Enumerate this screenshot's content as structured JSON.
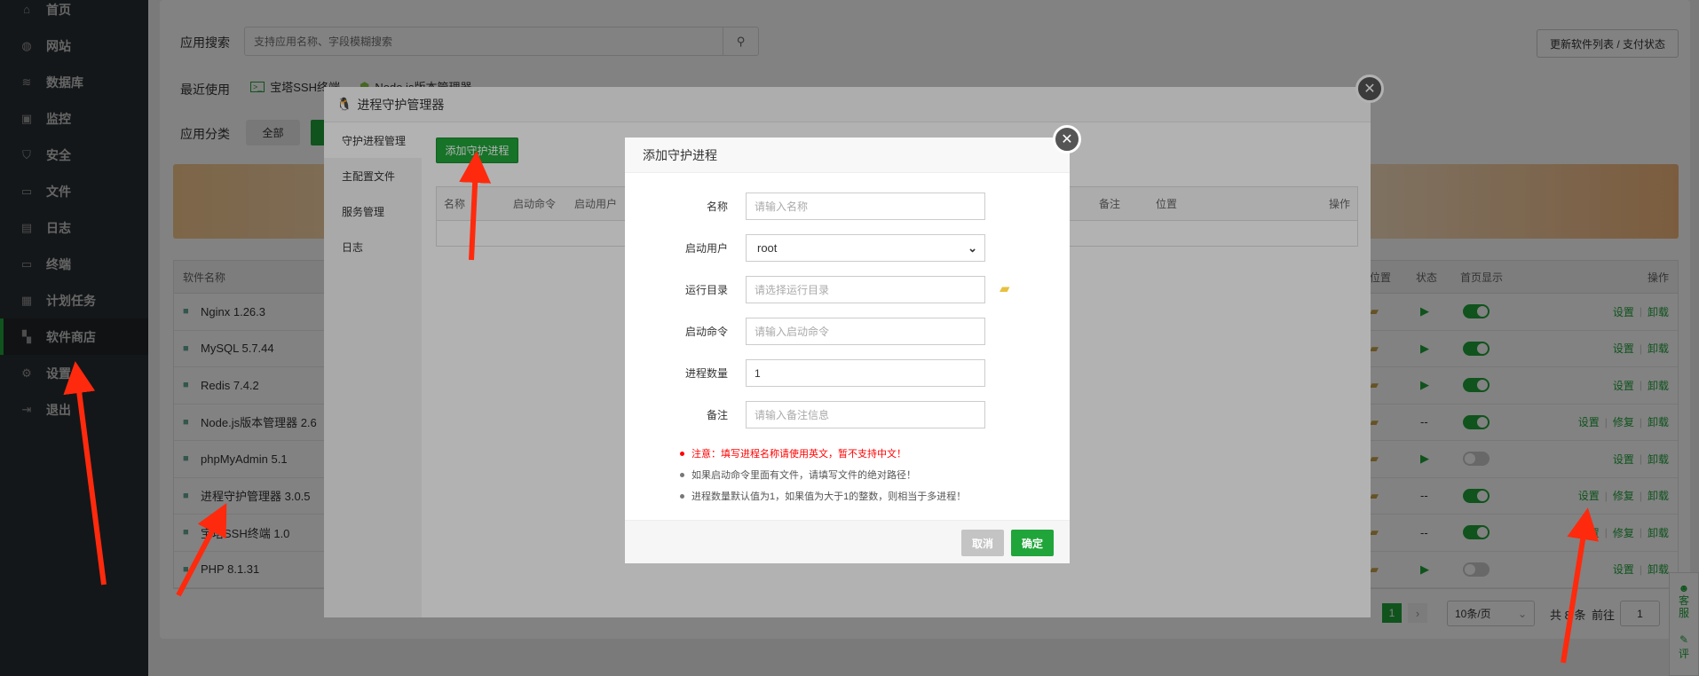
{
  "sidebar": {
    "items": [
      {
        "label": "首页",
        "icon": "home-icon",
        "glyph": "⌂"
      },
      {
        "label": "网站",
        "icon": "globe-icon",
        "glyph": "◍"
      },
      {
        "label": "数据库",
        "icon": "database-icon",
        "glyph": "≋"
      },
      {
        "label": "监控",
        "icon": "monitor-icon",
        "glyph": "▣"
      },
      {
        "label": "安全",
        "icon": "shield-icon",
        "glyph": "⛉"
      },
      {
        "label": "文件",
        "icon": "folder-icon",
        "glyph": "▭"
      },
      {
        "label": "日志",
        "icon": "log-icon",
        "glyph": "▤"
      },
      {
        "label": "终端",
        "icon": "terminal-icon",
        "glyph": "▭"
      },
      {
        "label": "计划任务",
        "icon": "calendar-icon",
        "glyph": "▦"
      },
      {
        "label": "软件商店",
        "icon": "apps-icon",
        "glyph": "▚"
      },
      {
        "label": "设置",
        "icon": "gear-icon",
        "glyph": "⚙"
      },
      {
        "label": "退出",
        "icon": "logout-icon",
        "glyph": "⇥"
      }
    ],
    "active": 9
  },
  "header": {
    "search_label": "应用搜索",
    "search_placeholder": "支持应用名称、字段模糊搜索",
    "update_button": "更新软件列表 / 支付状态",
    "recent_label": "最近使用",
    "recent": [
      "宝塔SSH终端",
      "Node.js版本管理器"
    ],
    "category_label": "应用分类",
    "category_all": "全部"
  },
  "table": {
    "headers": {
      "name": "软件名称",
      "location": "位置",
      "status": "状态",
      "home": "首页显示",
      "ops": "操作"
    },
    "rows": [
      {
        "name": "Nginx 1.26.3",
        "running": true,
        "home": true,
        "ops": [
          "设置",
          "卸载"
        ]
      },
      {
        "name": "MySQL 5.7.44",
        "running": true,
        "home": true,
        "ops": [
          "设置",
          "卸载"
        ]
      },
      {
        "name": "Redis 7.4.2",
        "running": true,
        "home": true,
        "ops": [
          "设置",
          "卸载"
        ]
      },
      {
        "name": "Node.js版本管理器 2.6",
        "running": null,
        "home": true,
        "ops": [
          "设置",
          "修复",
          "卸载"
        ]
      },
      {
        "name": "phpMyAdmin 5.1",
        "running": true,
        "home": false,
        "ops": [
          "设置",
          "卸载"
        ]
      },
      {
        "name": "进程守护管理器 3.0.5",
        "running": null,
        "home": true,
        "ops": [
          "设置",
          "修复",
          "卸载"
        ]
      },
      {
        "name": "宝塔SSH终端 1.0",
        "running": null,
        "home": true,
        "ops": [
          "设置",
          "修复",
          "卸载"
        ]
      },
      {
        "name": "PHP 8.1.31",
        "running": true,
        "home": false,
        "ops": [
          "设置",
          "卸载"
        ]
      }
    ],
    "status_none": "--"
  },
  "pagination": {
    "current": "1",
    "page_size": "10条/页",
    "total": "共 8 条",
    "goto_label": "前往",
    "goto_value": "1"
  },
  "float_tabs": [
    "客服",
    "评"
  ],
  "process_manager": {
    "title": "进程守护管理器",
    "nav": [
      "守护进程管理",
      "主配置文件",
      "服务管理",
      "日志"
    ],
    "add_button": "添加守护进程",
    "columns": [
      "名称",
      "启动命令",
      "启动用户",
      "备注",
      "位置",
      "操作"
    ]
  },
  "add_dialog": {
    "title": "添加守护进程",
    "fields": {
      "name": {
        "label": "名称",
        "placeholder": "请输入名称"
      },
      "user": {
        "label": "启动用户",
        "value": "root"
      },
      "dir": {
        "label": "运行目录",
        "placeholder": "请选择运行目录"
      },
      "cmd": {
        "label": "启动命令",
        "placeholder": "请输入启动命令"
      },
      "count": {
        "label": "进程数量",
        "value": "1"
      },
      "remark": {
        "label": "备注",
        "placeholder": "请输入备注信息"
      }
    },
    "notes": [
      "注意：填写进程名称请使用英文，暂不支持中文！",
      "如果启动命令里面有文件，请填写文件的绝对路径！",
      "进程数量默认值为1，如果值为大于1的整数，则相当于多进程！"
    ],
    "cancel": "取消",
    "confirm": "确定"
  },
  "colors": {
    "accent": "#20a53a",
    "warning": "#ff0000",
    "arrow": "#ff2a0d"
  }
}
